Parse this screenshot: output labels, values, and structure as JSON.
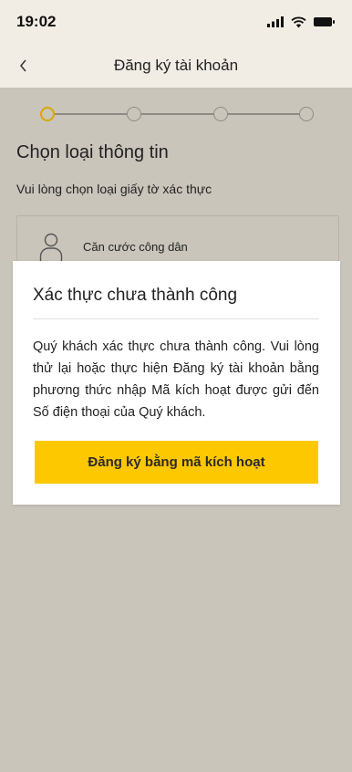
{
  "status_bar": {
    "time": "19:02"
  },
  "header": {
    "title": "Đăng ký tài khoản"
  },
  "stepper": {
    "total_steps": 4,
    "active_step": 1,
    "colors": {
      "active": "#d9a800",
      "inactive": "#8e8b85"
    }
  },
  "page": {
    "title": "Chọn loại thông tin",
    "subtitle": "Vui lòng chọn loại giấy tờ xác thực"
  },
  "option": {
    "label": "Căn cước công dân",
    "icon": "user-icon"
  },
  "modal": {
    "title": "Xác thực chưa thành công",
    "message": "Quý khách xác thực chưa thành công. Vui lòng thử lại hoặc thực hiện Đăng ký tài khoản bằng phương thức nhập Mã kích hoạt được gửi đến Số điện thoại của Quý khách.",
    "button_label": "Đăng ký bằng mã kích hoạt"
  },
  "colors": {
    "accent": "#fdc800",
    "overlay": "#c9c5bb",
    "header_bg": "#f1ede4"
  }
}
